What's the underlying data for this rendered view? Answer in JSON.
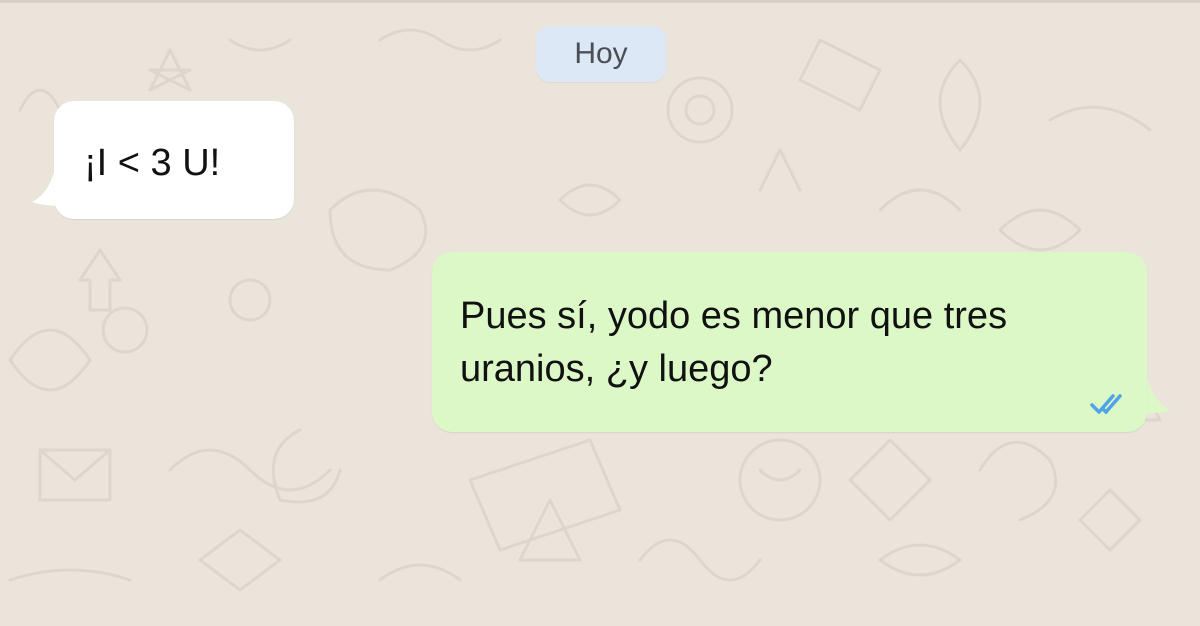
{
  "chat": {
    "date_chip": "Hoy",
    "messages": [
      {
        "direction": "incoming",
        "text": "¡I < 3 U!"
      },
      {
        "direction": "outgoing",
        "text": "Pues sí, yodo es menor que tres uranios, ¿y luego?",
        "status": "read"
      }
    ]
  },
  "colors": {
    "wallpaper": "#ebe4da",
    "date_chip_bg": "#dde8f6",
    "incoming_bubble": "#ffffff",
    "outgoing_bubble": "#dcf8c6",
    "read_ticks": "#4fa3e6"
  },
  "icons": {
    "read_receipt": "double-check-icon"
  }
}
